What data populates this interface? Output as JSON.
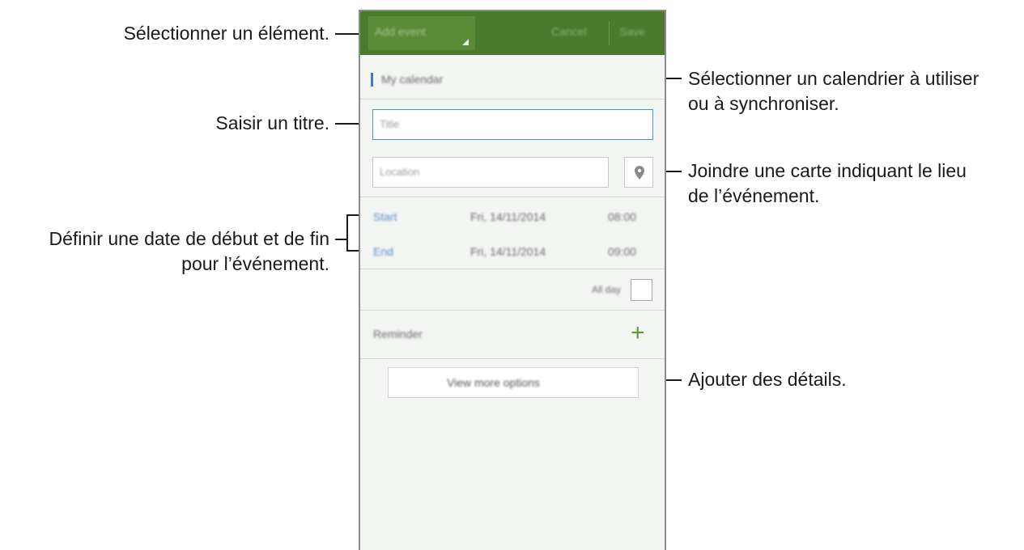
{
  "annotations": {
    "select_item": "Sélectionner un élément.",
    "select_calendar_line1": "Sélectionner un calendrier à utiliser",
    "select_calendar_line2": "ou à synchroniser.",
    "enter_title": "Saisir un titre.",
    "attach_map_line1": "Joindre une carte indiquant le lieu",
    "attach_map_line2": "de l’événement.",
    "set_dates_line1": "Définir une date de début et de fin",
    "set_dates_line2": "pour l’événement.",
    "add_details": "Ajouter des détails."
  },
  "screen": {
    "action_bar": {
      "dropdown_label": "Add event",
      "cancel_label": "Cancel",
      "save_label": "Save"
    },
    "calendar_label": "My calendar",
    "title_placeholder": "Title",
    "location_placeholder": "Location",
    "start": {
      "label": "Start",
      "date": "Fri, 14/11/2014",
      "time": "08:00"
    },
    "end": {
      "label": "End",
      "date": "Fri, 14/11/2014",
      "time": "09:00"
    },
    "all_day_label": "All day",
    "reminder_label": "Reminder",
    "view_more_label": "View more options"
  },
  "icons": {
    "map": "map-pin-icon",
    "add_reminder": "plus-icon"
  },
  "colors": {
    "action_bar": "#4a7a2c",
    "accent_blue": "#3a7dc2",
    "plus_green": "#5a9a36"
  }
}
